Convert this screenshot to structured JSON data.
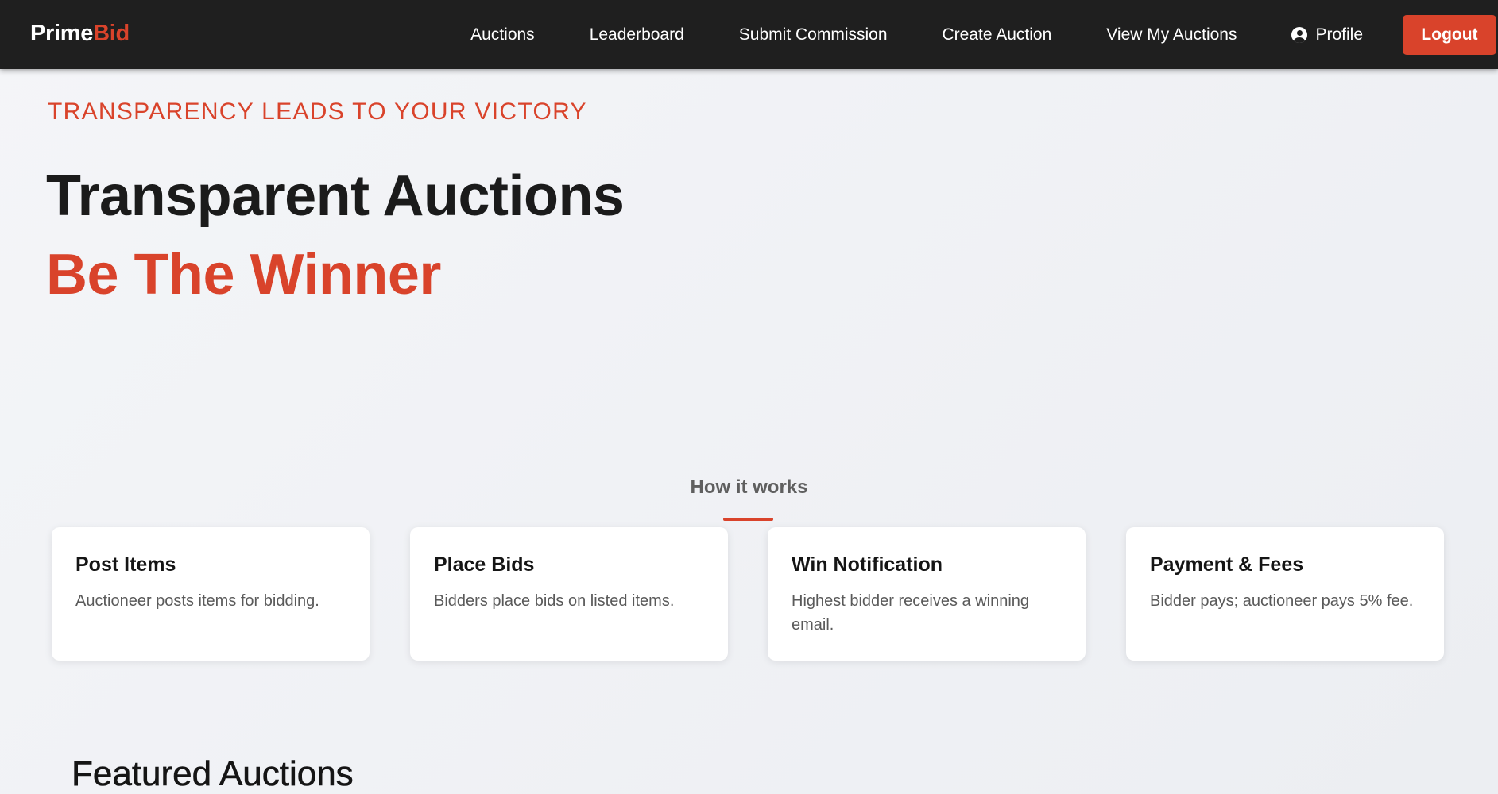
{
  "brand": {
    "part1": "Prime",
    "part2": "Bid"
  },
  "nav": {
    "auctions": "Auctions",
    "leaderboard": "Leaderboard",
    "submit_commission": "Submit Commission",
    "create_auction": "Create Auction",
    "view_my_auctions": "View My Auctions",
    "profile": "Profile",
    "profile_icon": "user-circle-icon",
    "logout": "Logout"
  },
  "hero": {
    "tagline": "TRANSPARENCY LEADS TO YOUR VICTORY",
    "title": "Transparent Auctions",
    "subtitle": "Be The Winner"
  },
  "how_it_works": {
    "heading": "How it works",
    "steps": [
      {
        "title": "Post Items",
        "text": "Auctioneer posts items for bidding."
      },
      {
        "title": "Place Bids",
        "text": "Bidders place bids on listed items."
      },
      {
        "title": "Win Notification",
        "text": "Highest bidder receives a winning email."
      },
      {
        "title": "Payment & Fees",
        "text": "Bidder pays; auctioneer pays 5% fee."
      }
    ]
  },
  "featured": {
    "heading": "Featured Auctions"
  },
  "colors": {
    "accent": "#d9432b",
    "navbar": "#1f1f1f",
    "heading_dark": "#1b1b1b",
    "muted_text": "#5a5a5a"
  }
}
